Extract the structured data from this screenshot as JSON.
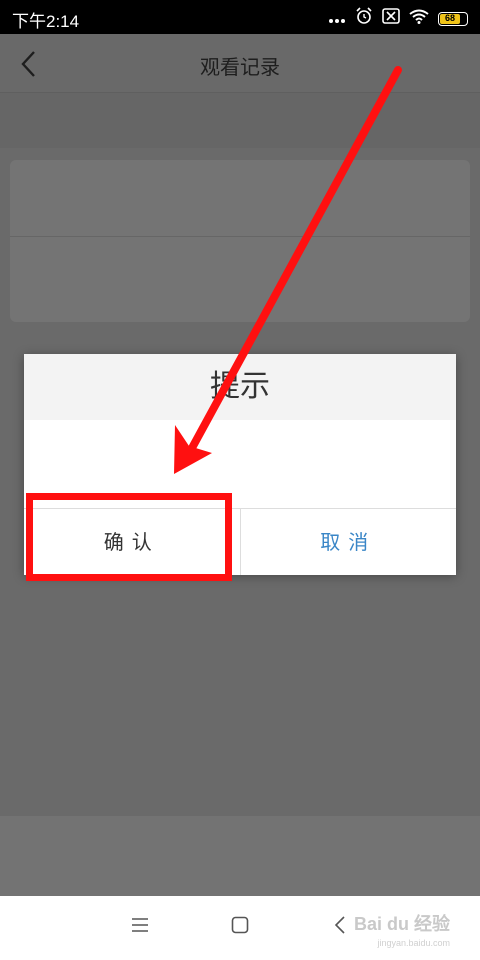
{
  "status_bar": {
    "time": "下午2:14",
    "battery": "68",
    "icons": [
      "more-dots-icon",
      "alarm-icon",
      "sim-off-icon",
      "wifi-icon",
      "battery-icon"
    ]
  },
  "header": {
    "title": "观看记录",
    "back_icon": "chevron-left-icon"
  },
  "dialog": {
    "title": "提示",
    "message": "",
    "confirm_label": "确认",
    "cancel_label": "取消",
    "cancel_color": "#3a86c7"
  },
  "annotation": {
    "color": "#ff1010",
    "arrow_target": "confirm-button"
  },
  "nav_bar": {
    "icons": [
      "menu-icon",
      "home-icon",
      "back-icon"
    ]
  },
  "watermark": {
    "text": "Bai du 经验",
    "sub": "jingyan.baidu.com"
  }
}
